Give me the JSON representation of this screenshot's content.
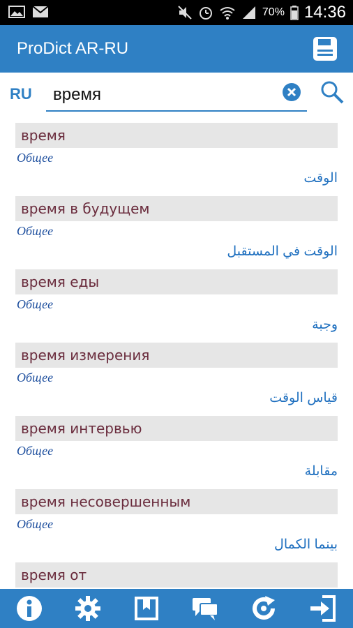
{
  "status": {
    "battery": "70%",
    "time": "14:36"
  },
  "app": {
    "title": "ProDict AR-RU"
  },
  "search": {
    "lang": "RU",
    "query": "время"
  },
  "results": [
    {
      "word": "время",
      "category": "Общее",
      "translation": "الوقت"
    },
    {
      "word": "время в будущем",
      "category": "Общее",
      "translation": "الوقت في المستقبل"
    },
    {
      "word": "время еды",
      "category": "Общее",
      "translation": "وجبة"
    },
    {
      "word": "время измерения",
      "category": "Общее",
      "translation": "قياس الوقت"
    },
    {
      "word": "время интервью",
      "category": "Общее",
      "translation": "مقابلة"
    },
    {
      "word": "время несовершенным",
      "category": "Общее",
      "translation": "بينما الكمال"
    },
    {
      "word": "время от",
      "category": "",
      "translation": ""
    }
  ],
  "icons": {
    "statusbar": [
      "image-icon",
      "gmail-icon",
      "mute-icon",
      "alarm-icon",
      "wifi-icon",
      "signal-icon",
      "battery-icon"
    ],
    "appbar": [
      "save-icon"
    ],
    "search": [
      "clear-icon",
      "search-icon"
    ],
    "bottombar": [
      "info-icon",
      "settings-icon",
      "bookmark-icon",
      "chat-icon",
      "refresh-icon",
      "exit-icon"
    ]
  },
  "colors": {
    "accent": "#2f80c4",
    "word": "#6a2c3d",
    "category": "#1e4f9e",
    "translation": "#1e6fbf"
  }
}
